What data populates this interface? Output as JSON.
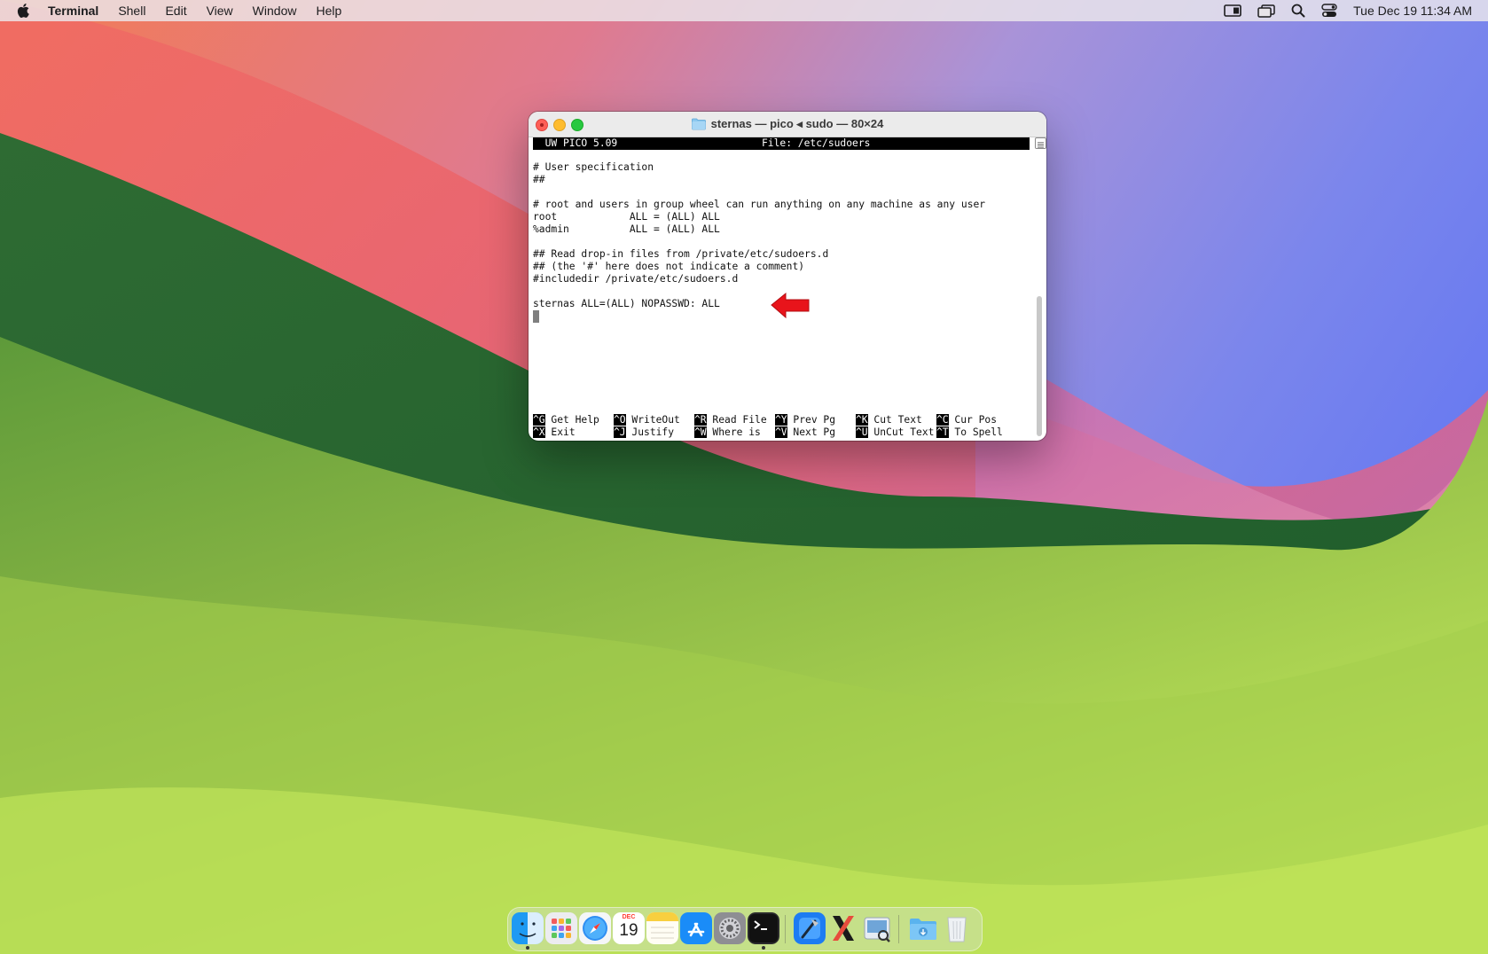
{
  "menubar": {
    "app_name": "Terminal",
    "items": [
      "Shell",
      "Edit",
      "View",
      "Window",
      "Help"
    ],
    "clock": "Tue Dec 19  11:34 AM",
    "status_icons": [
      "screen-mirroring-icon",
      "stage-manager-icon",
      "spotlight-search-icon",
      "control-center-icon"
    ]
  },
  "window": {
    "title": "sternas — pico ◂ sudo — 80×24"
  },
  "pico": {
    "version": "  UW PICO 5.09",
    "file_label": "File: /etc/sudoers",
    "lines": [
      "# User specification",
      "##",
      "",
      "# root and users in group wheel can run anything on any machine as any user",
      "root            ALL = (ALL) ALL",
      "%admin          ALL = (ALL) ALL",
      "",
      "## Read drop-in files from /private/etc/sudoers.d",
      "## (the '#' here does not indicate a comment)",
      "#includedir /private/etc/sudoers.d",
      "",
      "sternas ALL=(ALL) NOPASSWD: ALL"
    ],
    "shortcuts_row1": [
      {
        "key": "^G",
        "label": " Get Help"
      },
      {
        "key": "^O",
        "label": " WriteOut"
      },
      {
        "key": "^R",
        "label": " Read File"
      },
      {
        "key": "^Y",
        "label": " Prev Pg"
      },
      {
        "key": "^K",
        "label": " Cut Text"
      },
      {
        "key": "^C",
        "label": " Cur Pos"
      }
    ],
    "shortcuts_row2": [
      {
        "key": "^X",
        "label": " Exit"
      },
      {
        "key": "^J",
        "label": " Justify"
      },
      {
        "key": "^W",
        "label": " Where is"
      },
      {
        "key": "^V",
        "label": " Next Pg"
      },
      {
        "key": "^U",
        "label": " UnCut Text"
      },
      {
        "key": "^T",
        "label": " To Spell"
      }
    ]
  },
  "dock": {
    "apps": [
      "finder-icon",
      "launchpad-icon",
      "safari-icon",
      "calendar-icon",
      "notes-icon",
      "app-store-icon",
      "system-settings-icon",
      "terminal-icon",
      "xcode-icon",
      "x11-icon",
      "preview-icon",
      "downloads-folder-icon",
      "trash-icon"
    ],
    "calendar_month": "DEC",
    "calendar_day": "19"
  },
  "colors": {
    "annotation_arrow": "#e8141b"
  }
}
